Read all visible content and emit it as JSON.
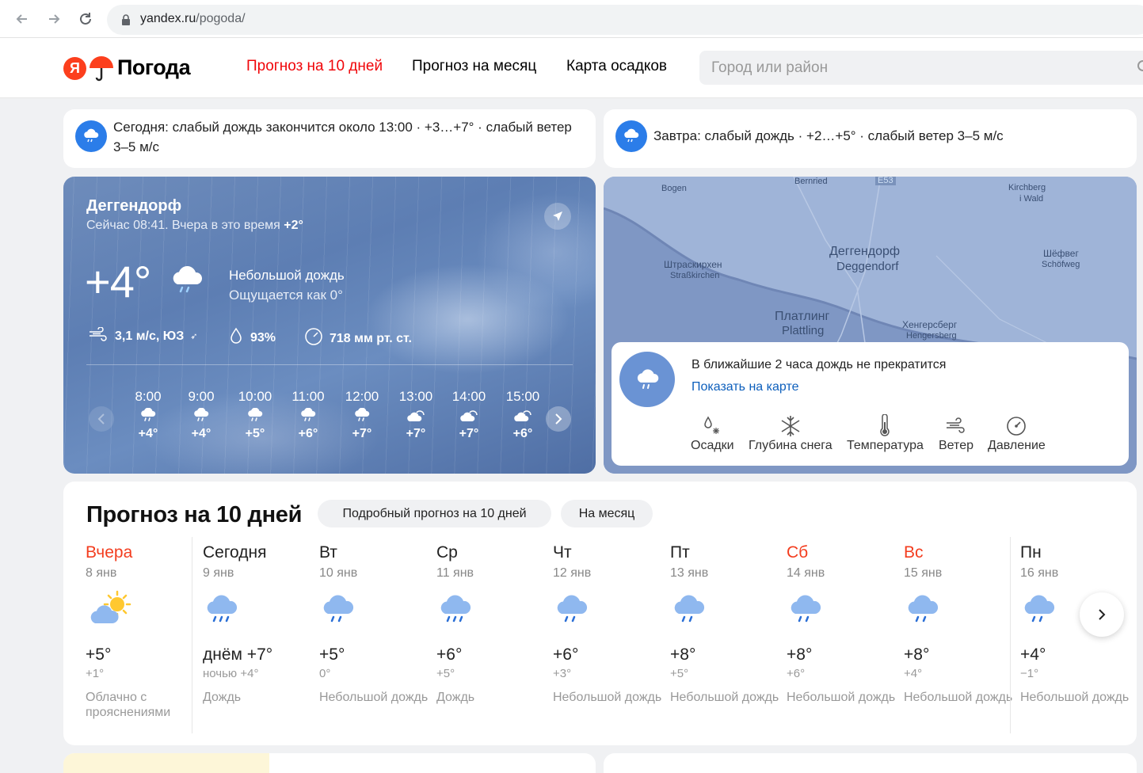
{
  "browser": {
    "url_domain": "yandex.ru",
    "url_path": "/pogoda/"
  },
  "header": {
    "logo_letter": "Я",
    "logo_text": "Погода",
    "nav": [
      "Прогноз на 10 дней",
      "Прогноз на месяц",
      "Карта осадков"
    ],
    "active_nav": 0,
    "search_placeholder": "Город или район"
  },
  "alerts": {
    "today": "Сегодня: слабый дождь закончится около 13:00 · +3…+7° · слабый ветер 3–5 м/с",
    "tomorrow": "Завтра: слабый дождь · +2…+5° · слабый ветер 3–5 м/с"
  },
  "current": {
    "city": "Деггендорф",
    "now_prefix": "Сейчас 08:41. Вчера в это время",
    "yesterday_temp": "+2°",
    "temp": "+4°",
    "condition": "Небольшой дождь",
    "feels_like": "Ощущается как 0°",
    "wind": "3,1 м/с, ЮЗ",
    "humidity": "93%",
    "pressure": "718 мм рт. ст."
  },
  "hourly": [
    {
      "time": "8:00",
      "temp": "+4°",
      "icon": "rain-icon"
    },
    {
      "time": "9:00",
      "temp": "+4°",
      "icon": "rain-icon"
    },
    {
      "time": "10:00",
      "temp": "+5°",
      "icon": "rain-icon"
    },
    {
      "time": "11:00",
      "temp": "+6°",
      "icon": "rain-icon"
    },
    {
      "time": "12:00",
      "temp": "+7°",
      "icon": "rain-icon"
    },
    {
      "time": "13:00",
      "temp": "+7°",
      "icon": "cloudy-icon"
    },
    {
      "time": "14:00",
      "temp": "+7°",
      "icon": "cloudy-icon"
    },
    {
      "time": "15:00",
      "temp": "+6°",
      "icon": "cloudy-icon"
    }
  ],
  "map": {
    "labels": [
      {
        "text": "Деггендорф",
        "small": false
      },
      {
        "text": "Deggendorf",
        "small": false
      },
      {
        "text": "Штраскирхен",
        "small": true
      },
      {
        "text": "Straßkirchen",
        "small": true
      },
      {
        "text": "Платлинг",
        "small": false
      },
      {
        "text": "Plattling",
        "small": false
      },
      {
        "text": "Хенгерсберг",
        "small": true
      },
      {
        "text": "Hengersberg",
        "small": true
      },
      {
        "text": "Шёфвег",
        "small": true
      },
      {
        "text": "Schöfweg",
        "small": true
      },
      {
        "text": "Bernried",
        "small": true
      },
      {
        "text": "Bogen",
        "small": true
      },
      {
        "text": "Kirchberg",
        "small": true
      },
      {
        "text": "i Wald",
        "small": true
      },
      {
        "text": "E53",
        "small": true
      }
    ],
    "popup_text": "В ближайшие 2 часа дождь не прекратится",
    "popup_link": "Показать на карте",
    "layers": [
      "Осадки",
      "Глубина снега",
      "Температура",
      "Ветер",
      "Давление"
    ]
  },
  "forecast": {
    "title": "Прогноз на 10 дней",
    "chip_detail": "Подробный прогноз на 10 дней",
    "chip_month": "На месяц",
    "days": [
      {
        "name": "Вчера",
        "date": "8 янв",
        "hi": "+5°",
        "lo": "+1°",
        "desc": "Облачно с прояснениями",
        "red": true,
        "icon": "partly-cloudy-icon"
      },
      {
        "name": "Сегодня",
        "date": "9 янв",
        "hi": "днём +7°",
        "lo": "ночью +4°",
        "desc": "Дождь",
        "red": false,
        "icon": "rain-icon"
      },
      {
        "name": "Вт",
        "date": "10 янв",
        "hi": "+5°",
        "lo": "0°",
        "desc": "Небольшой дождь",
        "red": false,
        "icon": "light-rain-icon"
      },
      {
        "name": "Ср",
        "date": "11 янв",
        "hi": "+6°",
        "lo": "+5°",
        "desc": "Дождь",
        "red": false,
        "icon": "rain-icon"
      },
      {
        "name": "Чт",
        "date": "12 янв",
        "hi": "+6°",
        "lo": "+3°",
        "desc": "Небольшой дождь",
        "red": false,
        "icon": "light-rain-icon"
      },
      {
        "name": "Пт",
        "date": "13 янв",
        "hi": "+8°",
        "lo": "+5°",
        "desc": "Небольшой дождь",
        "red": false,
        "icon": "light-rain-icon"
      },
      {
        "name": "Сб",
        "date": "14 янв",
        "hi": "+8°",
        "lo": "+6°",
        "desc": "Небольшой дождь",
        "red": true,
        "icon": "light-rain-icon"
      },
      {
        "name": "Вс",
        "date": "15 янв",
        "hi": "+8°",
        "lo": "+4°",
        "desc": "Небольшой дождь",
        "red": true,
        "icon": "light-rain-icon"
      },
      {
        "name": "Пн",
        "date": "16 янв",
        "hi": "+4°",
        "lo": "−1°",
        "desc": "Небольшой дождь",
        "red": false,
        "icon": "light-rain-icon"
      }
    ]
  },
  "colors": {
    "accent_red": "#f0060a",
    "weekend_red": "#f33d1f",
    "link_blue": "#0d5fbc",
    "alert_icon_blue": "#2b7de9"
  }
}
